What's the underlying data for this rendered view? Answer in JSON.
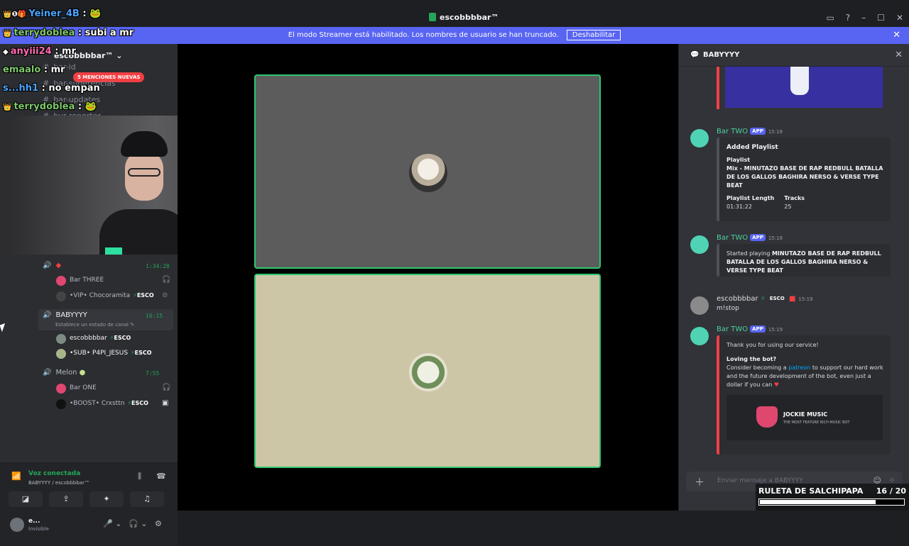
{
  "window": {
    "title": "escobbbbar™"
  },
  "streamer_bar": {
    "text": "El modo Streamer está habilitado. Los nombres de usuario se han truncado.",
    "button": "Deshabilitar"
  },
  "server": {
    "name": "escobbbbar™",
    "mentions_badge": "5 MENCIONES NUEVAS"
  },
  "channels": [
    "bar-id",
    "bar-sugerencias",
    "bar-updates",
    "bur-reporter"
  ],
  "voice_channels": [
    {
      "name": "",
      "timer": "1:34:28",
      "members": [
        {
          "name": "Bar THREE",
          "tag": ""
        },
        {
          "name": "•VIP• Chocoramita",
          "tag": "ESCO"
        }
      ]
    },
    {
      "name": "BABYYYY",
      "timer": "16:15",
      "status": "Establece un estado de canal",
      "members": [
        {
          "name": "escobbbbar",
          "tag": "ESCO"
        },
        {
          "name": "•SUB• P4PI_JESUS",
          "tag": "ESCO"
        }
      ]
    },
    {
      "name": "Melon",
      "timer": "7:55",
      "members": [
        {
          "name": "Bar ONE",
          "tag": ""
        },
        {
          "name": "•BOOST• Crxsttn",
          "tag": "ESCO"
        }
      ]
    }
  ],
  "voice_panel": {
    "label": "Voz conectada",
    "sub": "BABYYYY / escobbbbar™"
  },
  "user": {
    "name": "e...",
    "status": "Invisible"
  },
  "twitch_chat": [
    {
      "user": "Yeiner_4B",
      "msg": ""
    },
    {
      "user": "terrydoblea",
      "msg": "subi a mr"
    },
    {
      "user": "anyiii24",
      "msg": "mr"
    },
    {
      "user": "emaalo",
      "msg": "mr"
    },
    {
      "user": "s...hh1",
      "msg": "no empan"
    },
    {
      "user": "terrydoblea",
      "msg": ""
    }
  ],
  "right_panel": {
    "title": "BABYYYY",
    "messages": [
      {
        "author": "Bar TWO",
        "badge": "APP",
        "time": "15:18",
        "embed": {
          "title": "Added Playlist",
          "field1_label": "Playlist",
          "field1_value": "Mix - MINUTAZO BASE DE RAP REDBULL BATALLA DE LOS GALLOS BAGHIRA NERSO & VERSE TYPE BEAT",
          "len_label": "Playlist Length",
          "len_value": "01:31:22",
          "tracks_label": "Tracks",
          "tracks_value": "25"
        }
      },
      {
        "author": "Bar TWO",
        "badge": "APP",
        "time": "15:18",
        "embed": {
          "prefix": "Started playing",
          "track": "MINUTAZO BASE DE RAP REDBULL BATALLA DE LOS GALLOS BAGHIRA NERSO & VERSE TYPE BEAT"
        }
      },
      {
        "author": "escobbbbar",
        "badge": "ESCO",
        "time": "15:19",
        "text": "m!stop"
      },
      {
        "author": "Bar TWO",
        "badge": "APP",
        "time": "15:19",
        "embed": {
          "thanks": "Thank you for using our service!",
          "loving": "Loving the bot?",
          "p1": "Consider becoming a",
          "link": "patreon",
          "p2": "to support our hard work and the future development of the bot, even just a dollar if you can",
          "brand": "JOCKIE MUSIC",
          "brand_sub": "THE MOST FEATURE RICH MUSIC BOT"
        }
      }
    ],
    "input_placeholder": "Enviar mensaje a BABYYYY"
  },
  "ruleta": {
    "title": "RULETA DE SALCHIPAPA",
    "count": "16",
    "total": "/ 20",
    "progress": 0.8
  }
}
